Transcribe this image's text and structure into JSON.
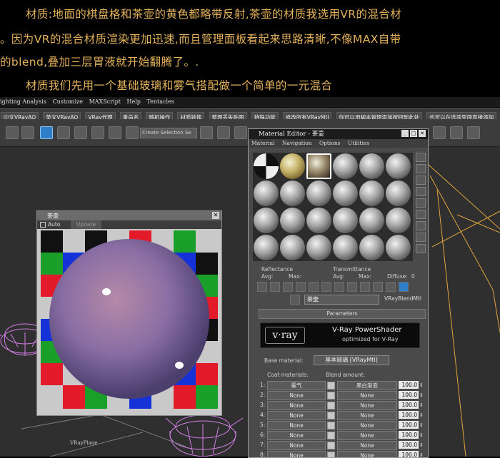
{
  "intro": {
    "line1": "材质:地面的棋盘格和茶壶的黄色都略带反射,茶壶的材质我选用VR的混合材",
    "line2": "。因为VR的混合材质渲染更加迅速,而且管理面板看起来思路清晰,不像MAX自带",
    "line3": "的blend,叠加三层胃液就开始翻腾了。.",
    "line4": "材质我们先用一个基础玻璃和雾气搭配做一个简单的一元混合"
  },
  "menubar": [
    "ighting Analysis",
    "Customize",
    "MAXScript",
    "Help",
    "Tentacles"
  ],
  "scriptbar": [
    "中文VRayAO",
    "英文VRayAO",
    "VRay代理",
    "重命名",
    "随机操作",
    "材质转换",
    "整理丢失贴图",
    "特殊功能",
    "修改所有VRayMtl",
    "你可以用脚本管理添加按钮到此处",
    "也可以在选项里面直接添加"
  ],
  "toolbar": {
    "selection_set": "Create Selection Se"
  },
  "preview": {
    "title": "茶壶",
    "auto": "Auto",
    "update": "Update"
  },
  "mat_editor": {
    "title": "Material Editor - 茶壶",
    "menus": [
      "Material",
      "Navigation",
      "Options",
      "Utilities"
    ],
    "reflectance": "Reflectance",
    "transmittance": "Transmittance",
    "avg1": "Avg:",
    "max1": "Max:",
    "avg2": "Avg:",
    "max2": "Max:",
    "diffuse": "Diffuse:",
    "diffuse_val": "0",
    "name": "茶壶",
    "type": "VRayBlendMtl",
    "rollout": "Parameters",
    "vray_logo": "v·ray",
    "vray_title": "V-Ray PowerShader",
    "vray_sub": "optimized for V-Ray",
    "base_label": "Base material:",
    "base_value": "基本玻璃 [VRayMtl]",
    "coat_header": "Coat materials:",
    "blend_header": "Blend amount:",
    "rows": [
      {
        "n": "1:",
        "coat": "雾气",
        "blend": "黑白渐变",
        "amt": "100.0"
      },
      {
        "n": "2:",
        "coat": "None",
        "blend": "None",
        "amt": "100.0"
      },
      {
        "n": "3:",
        "coat": "None",
        "blend": "None",
        "amt": "100.0"
      },
      {
        "n": "4:",
        "coat": "None",
        "blend": "None",
        "amt": "100.0"
      },
      {
        "n": "5:",
        "coat": "None",
        "blend": "None",
        "amt": "100.0"
      },
      {
        "n": "6:",
        "coat": "None",
        "blend": "None",
        "amt": "100.0"
      },
      {
        "n": "7:",
        "coat": "None",
        "blend": "None",
        "amt": "100.0"
      },
      {
        "n": "8:",
        "coat": "None",
        "blend": "None",
        "amt": "100.0"
      }
    ]
  },
  "viewport": {
    "label": "VRayPlane"
  },
  "colors": {
    "intro_text": "#e3b25a",
    "wire": "#d47fe6",
    "accent": "#2e7fc7"
  }
}
